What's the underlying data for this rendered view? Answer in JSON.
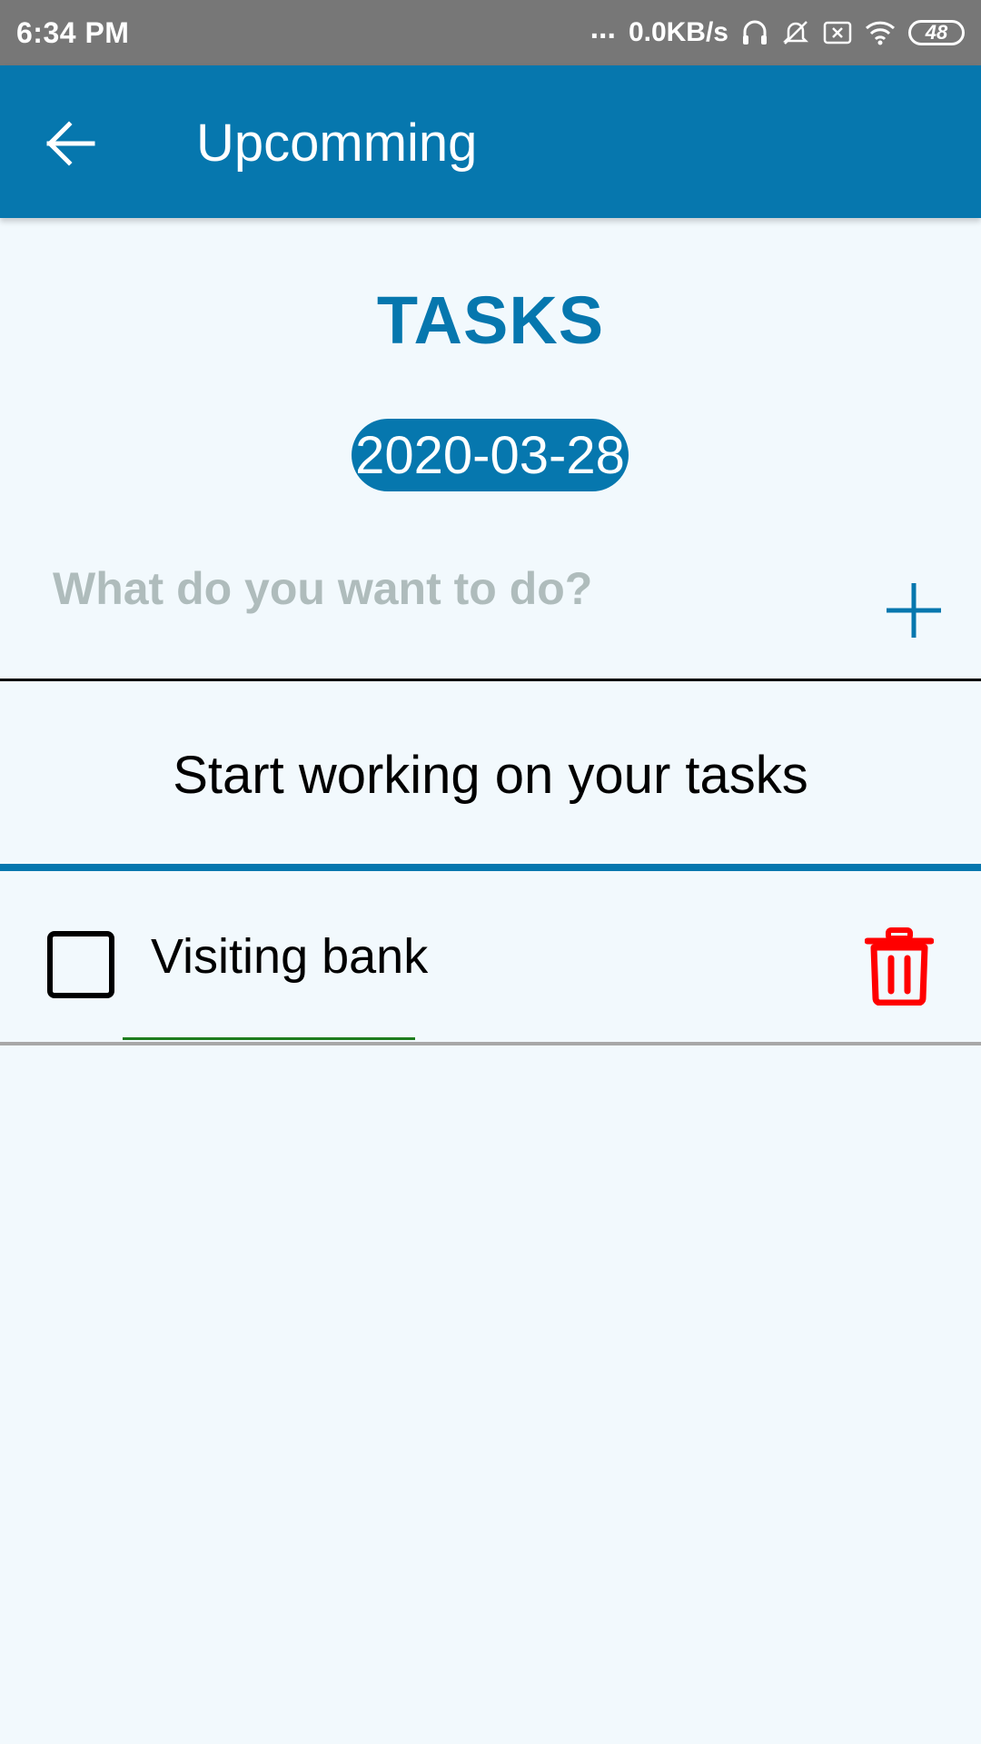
{
  "status_bar": {
    "time": "6:34 PM",
    "dots": "...",
    "network_speed": "0.0KB/s",
    "battery_level": "48",
    "icons": [
      "headphones-icon",
      "mute-icon",
      "no-sim-icon",
      "wifi-icon",
      "battery-icon"
    ]
  },
  "app_bar": {
    "title": "Upcomming",
    "back_icon": "arrow-left-icon"
  },
  "main": {
    "heading": "TASKS",
    "date": "2020-03-28",
    "input_placeholder": "What do you want to do?",
    "input_value": "",
    "add_icon": "plus-icon",
    "subtitle": "Start working on your tasks"
  },
  "tasks": [
    {
      "label": "Visiting bank",
      "checked": false,
      "delete_icon": "trash-icon"
    }
  ],
  "colors": {
    "primary": "#0677ae",
    "background": "#f2f9fd",
    "status_bar": "#777777",
    "delete": "#ff0000",
    "task_underline": "#1e7d1e",
    "placeholder": "#afbcbc"
  }
}
